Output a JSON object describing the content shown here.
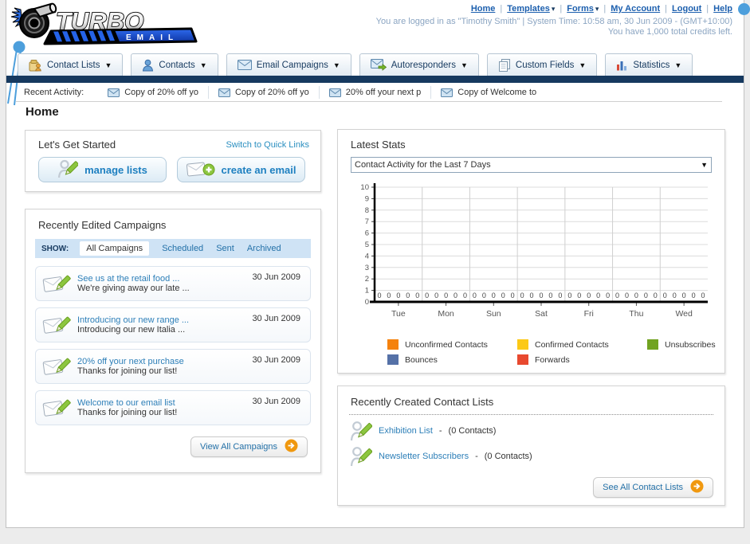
{
  "header": {
    "logo_title": "TURBO",
    "logo_subtitle": "EMAIL",
    "nav_links": [
      {
        "label": "Home",
        "dropdown": false
      },
      {
        "label": "Templates",
        "dropdown": true
      },
      {
        "label": "Forms",
        "dropdown": true
      },
      {
        "label": "My Account",
        "dropdown": false
      },
      {
        "label": "Logout",
        "dropdown": false
      },
      {
        "label": "Help",
        "dropdown": false
      }
    ],
    "login_info": "You are logged in as \"Timothy Smith\" | System Time: 10:58 am, 30 Jun 2009 - (GMT+10:00)",
    "credits_info": "You have 1,000 total credits left."
  },
  "nav_tabs": [
    {
      "label": "Contact Lists",
      "icon": "contact-lists-icon"
    },
    {
      "label": "Contacts",
      "icon": "contacts-icon"
    },
    {
      "label": "Email Campaigns",
      "icon": "email-campaigns-icon"
    },
    {
      "label": "Autoresponders",
      "icon": "autoresponders-icon"
    },
    {
      "label": "Custom Fields",
      "icon": "custom-fields-icon"
    },
    {
      "label": "Statistics",
      "icon": "statistics-icon"
    }
  ],
  "recent_activity": {
    "label": "Recent Activity:",
    "items": [
      "Copy of 20% off yo",
      "Copy of 20% off yo",
      "20% off your next p",
      "Copy of Welcome to"
    ]
  },
  "page": {
    "title": "Home"
  },
  "get_started": {
    "title": "Let's Get Started",
    "switch_link": "Switch to Quick Links",
    "manage_lists_label": "manage lists",
    "create_email_label": "create an email"
  },
  "campaigns": {
    "title": "Recently Edited Campaigns",
    "show_label": "SHOW:",
    "filters": [
      "All Campaigns",
      "Scheduled",
      "Sent",
      "Archived"
    ],
    "active_filter": "All Campaigns",
    "rows": [
      {
        "title": "See us at the retail food ...",
        "subtitle": "We're giving away our late ...",
        "date": "30 Jun 2009"
      },
      {
        "title": "Introducing our new range ...",
        "subtitle": "Introducing our new Italia ...",
        "date": "30 Jun 2009"
      },
      {
        "title": "20% off your next purchase",
        "subtitle": "Thanks for joining our list!",
        "date": "30 Jun 2009"
      },
      {
        "title": "Welcome to our email list",
        "subtitle": "Thanks for joining our list!",
        "date": "30 Jun 2009"
      }
    ],
    "view_all_label": "View All Campaigns"
  },
  "latest_stats": {
    "title": "Latest Stats",
    "period_selected": "Contact Activity for the Last 7 Days"
  },
  "chart_data": {
    "type": "bar",
    "title": "Contact Activity for the Last 7 Days",
    "categories": [
      "Tue",
      "Mon",
      "Sun",
      "Sat",
      "Fri",
      "Thu",
      "Wed"
    ],
    "series": [
      {
        "name": "Unconfirmed Contacts",
        "color": "#f5820d",
        "values": [
          0,
          0,
          0,
          0,
          0,
          0,
          0
        ]
      },
      {
        "name": "Confirmed Contacts",
        "color": "#fcc916",
        "values": [
          0,
          0,
          0,
          0,
          0,
          0,
          0
        ]
      },
      {
        "name": "Unsubscribes",
        "color": "#71a321",
        "values": [
          0,
          0,
          0,
          0,
          0,
          0,
          0
        ]
      },
      {
        "name": "Bounces",
        "color": "#5571a7",
        "values": [
          0,
          0,
          0,
          0,
          0,
          0,
          0
        ]
      },
      {
        "name": "Forwards",
        "color": "#e8492f",
        "values": [
          0,
          0,
          0,
          0,
          0,
          0,
          0
        ]
      }
    ],
    "ylim": [
      0,
      10
    ],
    "yticks": [
      0,
      1,
      2,
      3,
      4,
      5,
      6,
      7,
      8,
      9,
      10
    ],
    "grid": true,
    "legend_position": "bottom",
    "xlabel": "",
    "ylabel": ""
  },
  "contact_lists": {
    "title": "Recently Created Contact Lists",
    "items": [
      {
        "name": "Exhibition List",
        "separator": "-",
        "count": "(0 Contacts)"
      },
      {
        "name": "Newsletter Subscribers",
        "separator": "-",
        "count": "(0 Contacts)"
      }
    ],
    "see_all_label": "See All Contact Lists"
  },
  "colors": {
    "nav_bar_navy": "#16395f",
    "header_link_blue": "#1c5fae",
    "panel_link_teal": "#2d7fb8",
    "arrow_button_orange": "#f0980f",
    "filter_bar_blue": "#cfe3f5"
  }
}
